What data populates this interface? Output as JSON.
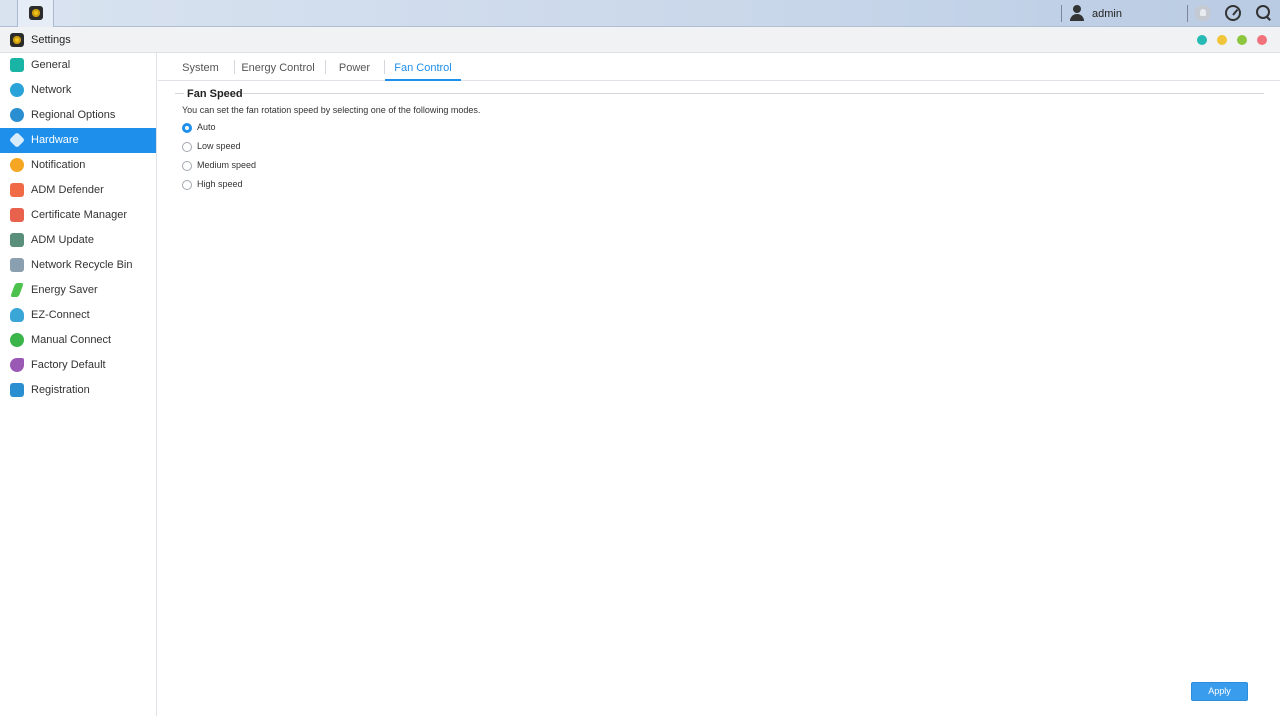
{
  "taskbar": {
    "username": "admin",
    "icons": [
      "settings-app-icon",
      "user-icon",
      "notification-bell-icon",
      "dashboard-icon",
      "search-icon"
    ]
  },
  "window": {
    "title": "Settings",
    "controls": [
      {
        "name": "teal-control",
        "color": "#27b9b3"
      },
      {
        "name": "yellow-control",
        "color": "#f0c53a"
      },
      {
        "name": "green-control",
        "color": "#8cc63e"
      },
      {
        "name": "red-control",
        "color": "#f0727b"
      }
    ]
  },
  "sidebar": {
    "items": [
      {
        "label": "General",
        "icon": "general-icon",
        "color": "#19b4a6"
      },
      {
        "label": "Network",
        "icon": "globe-icon",
        "color": "#2aa3d8"
      },
      {
        "label": "Regional Options",
        "icon": "regional-options-icon",
        "color": "#2a8fd0"
      },
      {
        "label": "Hardware",
        "icon": "hardware-icon",
        "color": "#5aa7ea",
        "active": true
      },
      {
        "label": "Notification",
        "icon": "notification-icon",
        "color": "#f5a623"
      },
      {
        "label": "ADM Defender",
        "icon": "firewall-icon",
        "color": "#f06a45"
      },
      {
        "label": "Certificate Manager",
        "icon": "certificate-icon",
        "color": "#e8614d"
      },
      {
        "label": "ADM Update",
        "icon": "update-icon",
        "color": "#5a8f7b"
      },
      {
        "label": "Network Recycle Bin",
        "icon": "recycle-bin-icon",
        "color": "#8aa0b0"
      },
      {
        "label": "Energy Saver",
        "icon": "energy-saver-icon",
        "color": "#4cc24c"
      },
      {
        "label": "EZ-Connect",
        "icon": "ez-connect-icon",
        "color": "#3aa6d8"
      },
      {
        "label": "Manual Connect",
        "icon": "manual-connect-icon",
        "color": "#3bb54a"
      },
      {
        "label": "Factory Default",
        "icon": "factory-default-icon",
        "color": "#9b59b6"
      },
      {
        "label": "Registration",
        "icon": "registration-icon",
        "color": "#2a8fd0"
      }
    ]
  },
  "tabs": [
    {
      "label": "System"
    },
    {
      "label": "Energy Control"
    },
    {
      "label": "Power"
    },
    {
      "label": "Fan Control",
      "active": true
    }
  ],
  "fan_speed": {
    "title": "Fan Speed",
    "description": "You can set the fan rotation speed by selecting one of the following modes.",
    "options": [
      {
        "label": "Auto",
        "checked": true
      },
      {
        "label": "Low speed",
        "checked": false
      },
      {
        "label": "Medium speed",
        "checked": false
      },
      {
        "label": "High speed",
        "checked": false
      }
    ]
  },
  "apply_label": "Apply",
  "accent_color": "#1e8fea"
}
